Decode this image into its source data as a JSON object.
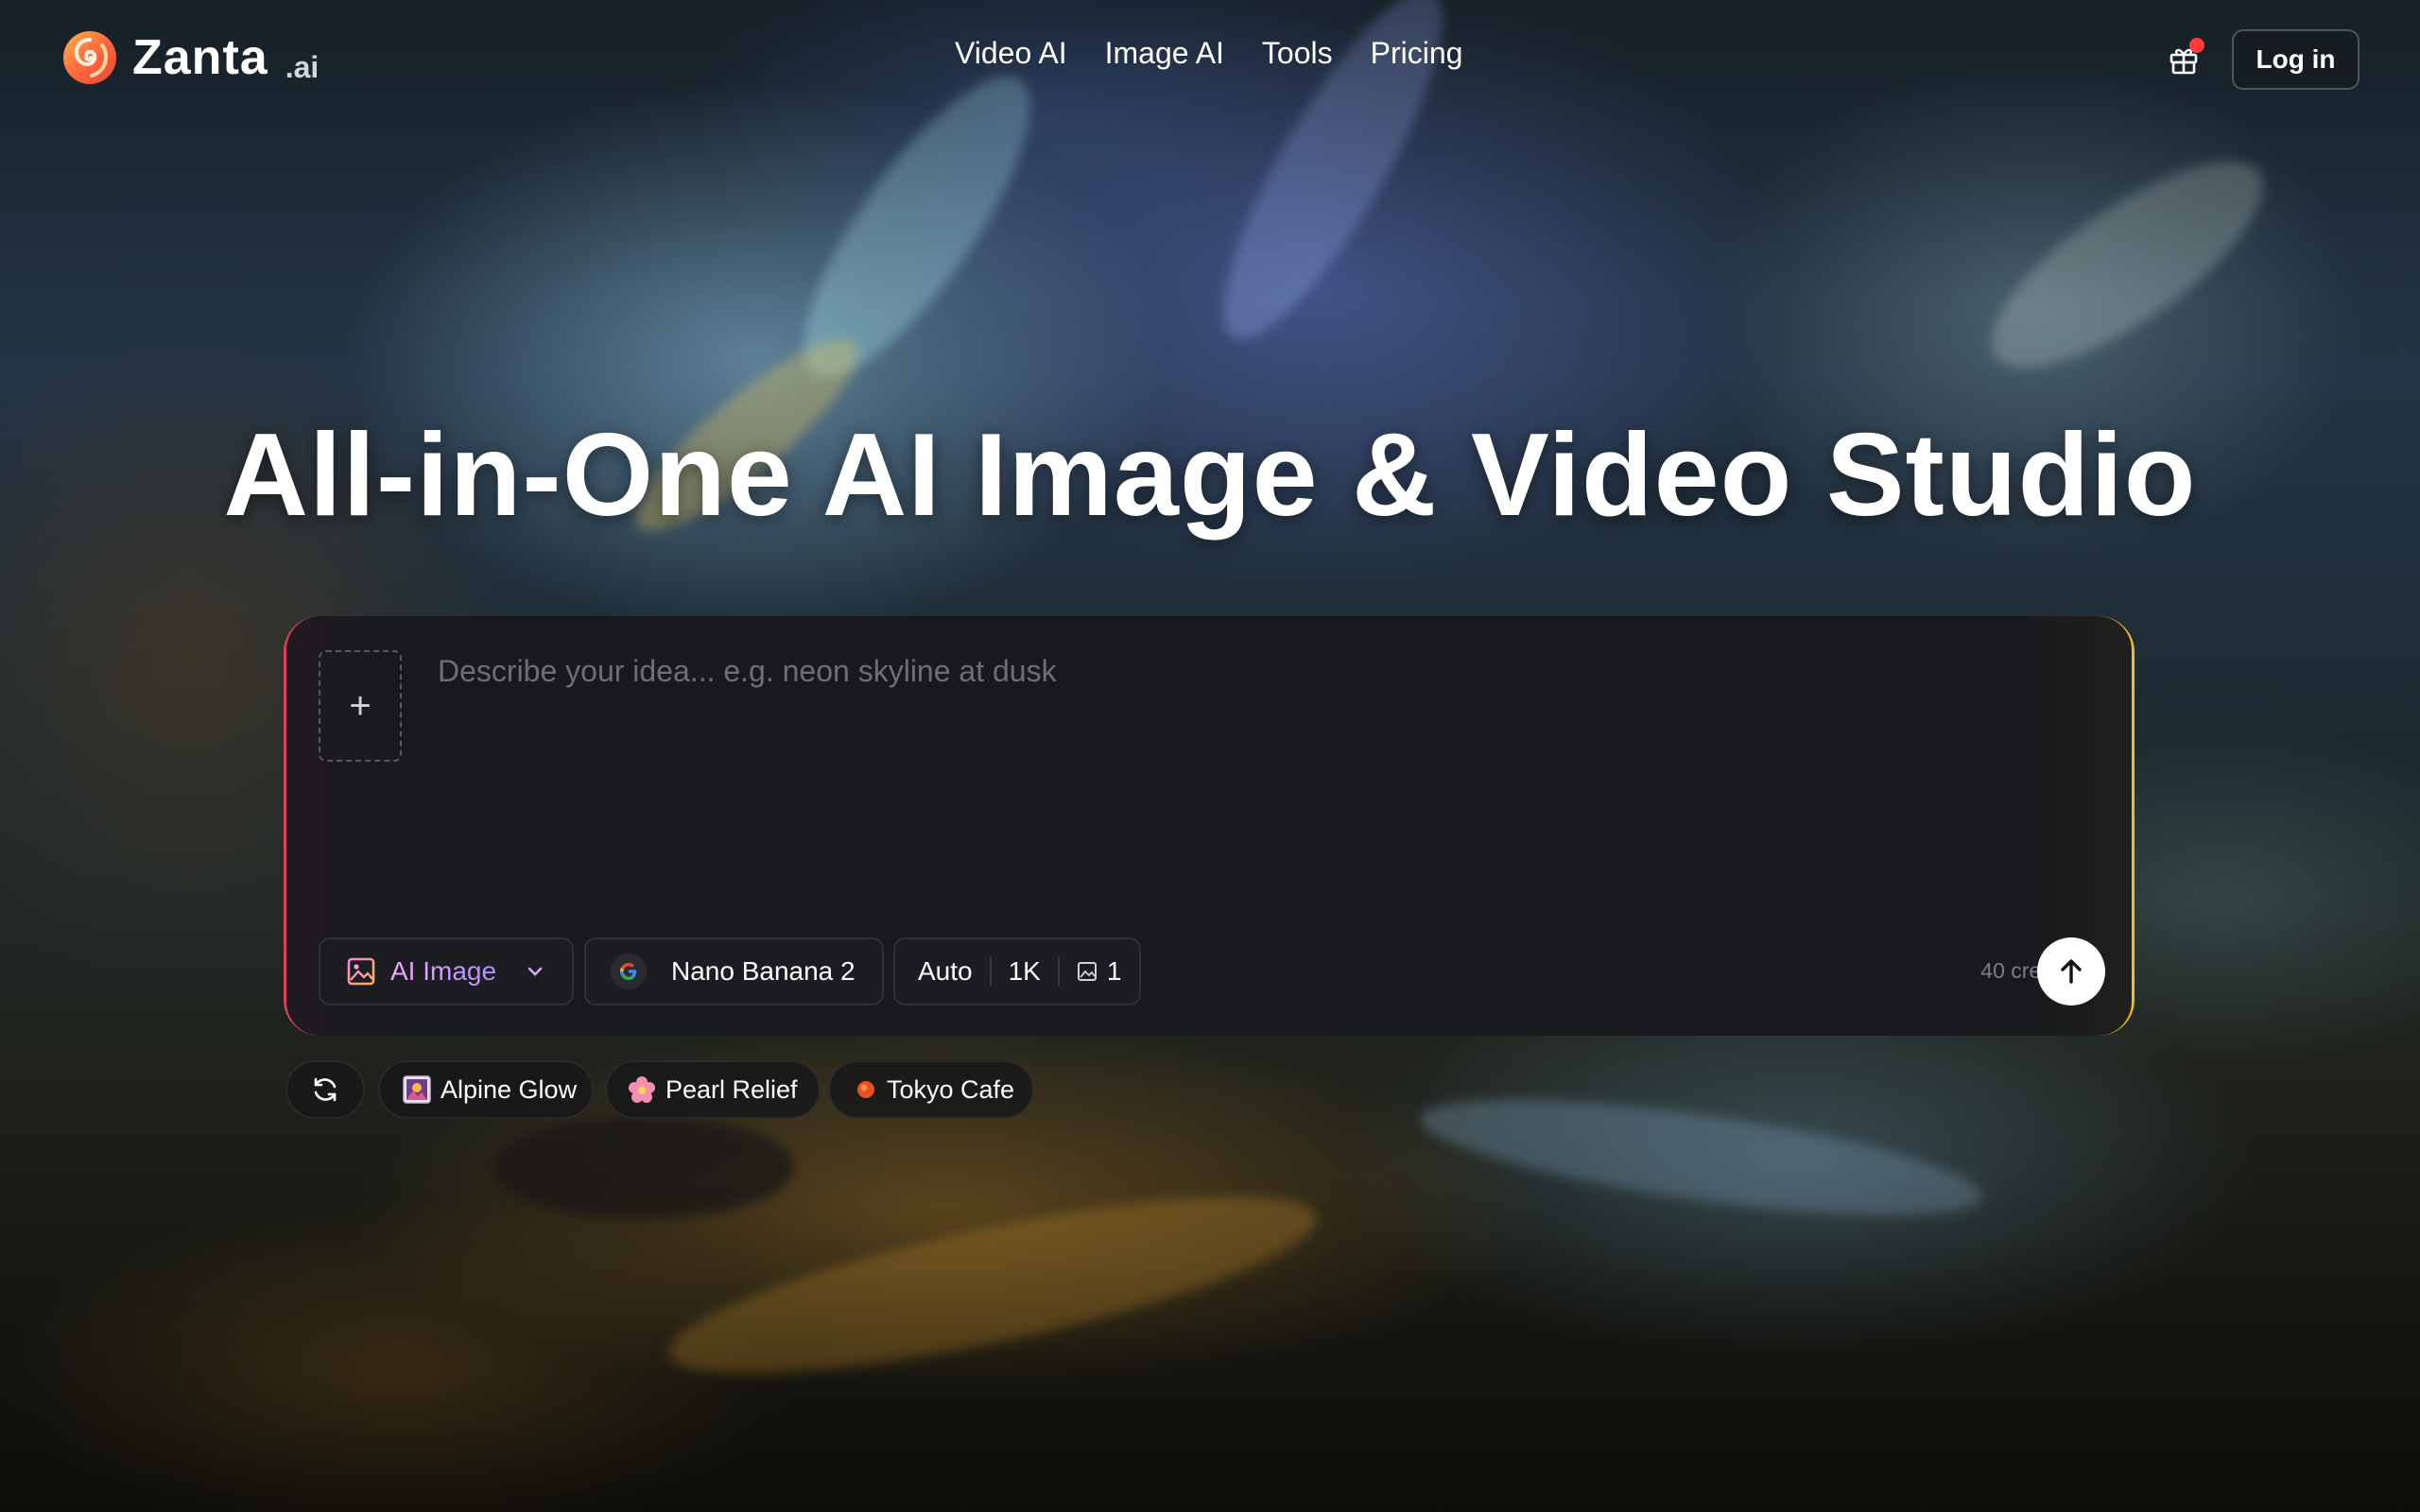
{
  "brand": {
    "name": "Zanta",
    "suffix": ".ai"
  },
  "nav": {
    "items": [
      {
        "label": "Video AI"
      },
      {
        "label": "Image AI"
      },
      {
        "label": "Tools"
      },
      {
        "label": "Pricing"
      }
    ]
  },
  "header": {
    "gift_icon": "gift-icon",
    "login_label": "Log in"
  },
  "hero": {
    "title": "All-in-One AI Image & Video Studio"
  },
  "composer": {
    "add_icon": "plus-icon",
    "placeholder": "Describe your idea... e.g. neon skyline at dusk",
    "value": "",
    "type_selector": {
      "icon": "image-icon",
      "label": "AI Image",
      "chevron": "chevron-down-icon"
    },
    "model_selector": {
      "icon": "google-g-icon",
      "label": "Nano Banana 2"
    },
    "options": {
      "aspect": "Auto",
      "resolution": "1K",
      "count_icon": "image-icon",
      "count": "1"
    },
    "credits": "40 credits",
    "send_icon": "arrow-up-icon"
  },
  "suggestions": {
    "refresh_icon": "refresh-icon",
    "items": [
      {
        "icon": "landscape-thumbnail-icon",
        "label": "Alpine Glow"
      },
      {
        "icon": "flower-icon",
        "label": "Pearl Relief"
      },
      {
        "icon": "orange-dot-icon",
        "label": "Tokyo Cafe"
      }
    ]
  },
  "colors": {
    "card_bg": "#18191d",
    "border_left_accent": "#e0405a",
    "border_right_accent": "#f0c020",
    "ai_image_gradient": [
      "#f3a7ff",
      "#b28cff"
    ],
    "notification_dot": "#ff3b3b"
  }
}
